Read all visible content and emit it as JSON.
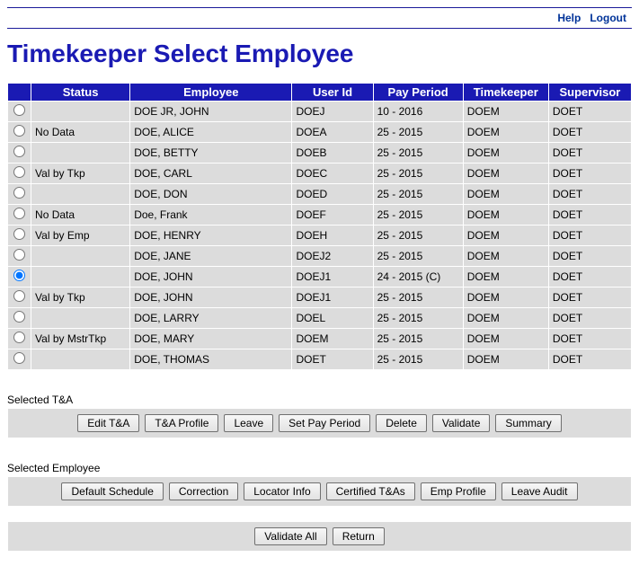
{
  "top_nav": {
    "help": "Help",
    "logout": "Logout"
  },
  "page_title": "Timekeeper Select Employee",
  "table": {
    "headers": {
      "radio": "",
      "status": "Status",
      "employee": "Employee",
      "userid": "User Id",
      "payperiod": "Pay Period",
      "timekeeper": "Timekeeper",
      "supervisor": "Supervisor"
    },
    "rows": [
      {
        "selected": false,
        "status": "",
        "employee": "DOE JR, JOHN",
        "userid": "DOEJ",
        "payperiod": "10 - 2016",
        "timekeeper": "DOEM",
        "supervisor": "DOET"
      },
      {
        "selected": false,
        "status": "No Data",
        "employee": "DOE, ALICE",
        "userid": "DOEA",
        "payperiod": "25 - 2015",
        "timekeeper": "DOEM",
        "supervisor": "DOET"
      },
      {
        "selected": false,
        "status": "",
        "employee": "DOE, BETTY",
        "userid": "DOEB",
        "payperiod": "25 - 2015",
        "timekeeper": "DOEM",
        "supervisor": "DOET"
      },
      {
        "selected": false,
        "status": "Val by Tkp",
        "employee": "DOE, CARL",
        "userid": "DOEC",
        "payperiod": "25 - 2015",
        "timekeeper": "DOEM",
        "supervisor": "DOET"
      },
      {
        "selected": false,
        "status": "",
        "employee": "DOE, DON",
        "userid": "DOED",
        "payperiod": "25 - 2015",
        "timekeeper": "DOEM",
        "supervisor": "DOET"
      },
      {
        "selected": false,
        "status": "No Data",
        "employee": "Doe, Frank",
        "userid": "DOEF",
        "payperiod": "25 - 2015",
        "timekeeper": "DOEM",
        "supervisor": "DOET"
      },
      {
        "selected": false,
        "status": "Val by Emp",
        "employee": "DOE, HENRY",
        "userid": "DOEH",
        "payperiod": "25 - 2015",
        "timekeeper": "DOEM",
        "supervisor": "DOET"
      },
      {
        "selected": false,
        "status": "",
        "employee": "DOE, JANE",
        "userid": "DOEJ2",
        "payperiod": "25 - 2015",
        "timekeeper": "DOEM",
        "supervisor": "DOET"
      },
      {
        "selected": true,
        "status": "",
        "employee": "DOE, JOHN",
        "userid": "DOEJ1",
        "payperiod": "24 - 2015 (C)",
        "timekeeper": "DOEM",
        "supervisor": "DOET"
      },
      {
        "selected": false,
        "status": "Val by Tkp",
        "employee": "DOE, JOHN",
        "userid": "DOEJ1",
        "payperiod": "25 - 2015",
        "timekeeper": "DOEM",
        "supervisor": "DOET"
      },
      {
        "selected": false,
        "status": "",
        "employee": "DOE, LARRY",
        "userid": "DOEL",
        "payperiod": "25 - 2015",
        "timekeeper": "DOEM",
        "supervisor": "DOET"
      },
      {
        "selected": false,
        "status": "Val by MstrTkp",
        "employee": "DOE, MARY",
        "userid": "DOEM",
        "payperiod": "25 - 2015",
        "timekeeper": "DOEM",
        "supervisor": "DOET"
      },
      {
        "selected": false,
        "status": "",
        "employee": "DOE, THOMAS",
        "userid": "DOET",
        "payperiod": "25 - 2015",
        "timekeeper": "DOEM",
        "supervisor": "DOET"
      }
    ]
  },
  "sections": {
    "ta_label": "Selected T&A",
    "ta_buttons": {
      "edit_ta": "Edit T&A",
      "ta_profile": "T&A Profile",
      "leave": "Leave",
      "set_pay_period": "Set Pay Period",
      "delete": "Delete",
      "validate": "Validate",
      "summary": "Summary"
    },
    "emp_label": "Selected Employee",
    "emp_buttons": {
      "default_schedule": "Default Schedule",
      "correction": "Correction",
      "locator_info": "Locator Info",
      "certified_tas": "Certified T&As",
      "emp_profile": "Emp Profile",
      "leave_audit": "Leave Audit"
    },
    "footer_buttons": {
      "validate_all": "Validate All",
      "return": "Return"
    }
  }
}
